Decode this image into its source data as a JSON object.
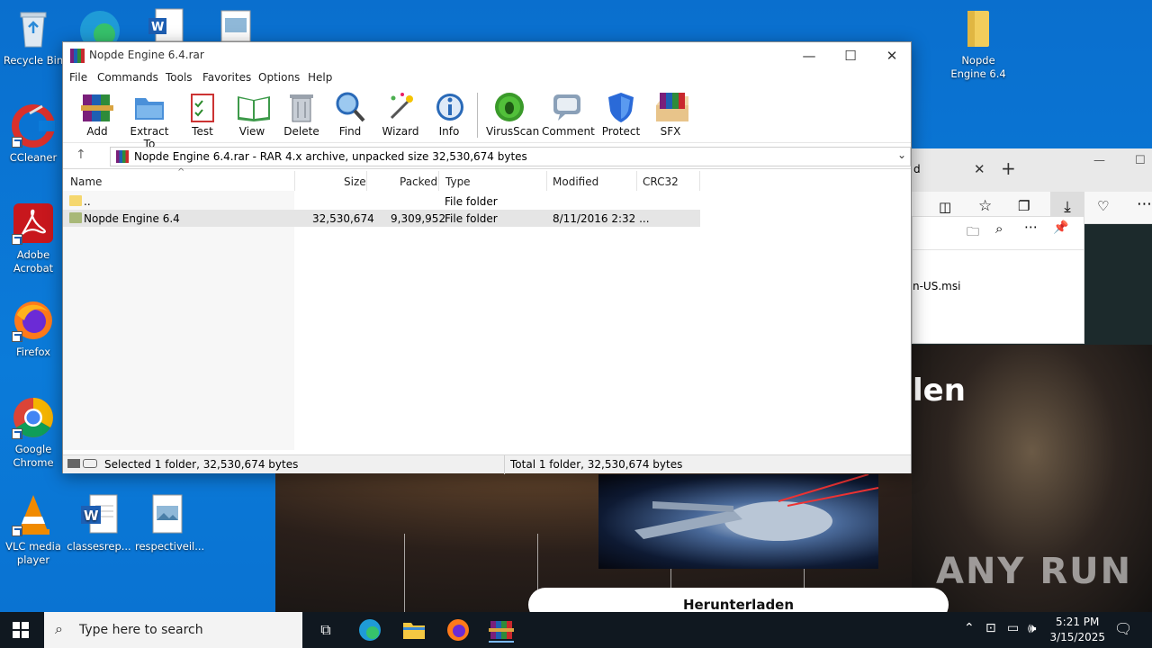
{
  "desktop_icons": [
    {
      "label": "Recycle Bin",
      "icon": "recycle-bin-icon"
    },
    {
      "label": "CCleaner",
      "icon": "ccleaner-icon"
    },
    {
      "label": "Adobe Acrobat",
      "icon": "acrobat-icon"
    },
    {
      "label": "Firefox",
      "icon": "firefox-icon"
    },
    {
      "label": "Google Chrome",
      "icon": "chrome-icon"
    },
    {
      "label": "VLC media player",
      "icon": "vlc-icon"
    },
    {
      "label": "classesrep...",
      "icon": "word-doc-icon"
    },
    {
      "label": "respectiveil...",
      "icon": "image-file-icon"
    },
    {
      "label": "Nopde Engine 6.4",
      "icon": "folder-icon"
    }
  ],
  "winrar": {
    "title": "Nopde Engine 6.4.rar",
    "window_buttons": {
      "minimize": "—",
      "maximize": "☐",
      "close": "✕"
    },
    "menu": [
      "File",
      "Commands",
      "Tools",
      "Favorites",
      "Options",
      "Help"
    ],
    "toolbar": [
      {
        "label": "Add",
        "icon": "add-archive-icon"
      },
      {
        "label": "Extract To",
        "icon": "extract-folder-icon"
      },
      {
        "label": "Test",
        "icon": "test-clipboard-icon"
      },
      {
        "label": "View",
        "icon": "view-book-icon"
      },
      {
        "label": "Delete",
        "icon": "trash-icon"
      },
      {
        "label": "Find",
        "icon": "magnifier-icon"
      },
      {
        "label": "Wizard",
        "icon": "wand-icon"
      },
      {
        "label": "Info",
        "icon": "info-icon"
      },
      {
        "label": "VirusScan",
        "icon": "bug-scan-icon"
      },
      {
        "label": "Comment",
        "icon": "comment-icon"
      },
      {
        "label": "Protect",
        "icon": "shield-icon"
      },
      {
        "label": "SFX",
        "icon": "sfx-box-icon"
      }
    ],
    "address": "Nopde Engine 6.4.rar - RAR 4.x archive, unpacked size 32,530,674 bytes",
    "columns": [
      "Name",
      "Size",
      "Packed",
      "Type",
      "Modified",
      "CRC32"
    ],
    "rows": [
      {
        "name": "..",
        "size": "",
        "packed": "",
        "type": "File folder",
        "modified": "",
        "crc": "",
        "color": "#f5d76e"
      },
      {
        "name": "Nopde Engine 6.4",
        "size": "32,530,674",
        "packed": "9,309,952",
        "type": "File folder",
        "modified": "8/11/2016 2:32 ...",
        "crc": "",
        "color": "#a8b878"
      }
    ],
    "status_left": "Selected 1 folder, 32,530,674 bytes",
    "status_right": "Total 1 folder, 32,530,674 bytes"
  },
  "browser": {
    "tab_fragment": "d",
    "download_item": "n-US.msi",
    "heading_fragment": "len",
    "download_button": "Herunterladen",
    "watermark": "ANY RUN"
  },
  "taskbar": {
    "search_placeholder": "Type here to search",
    "time": "5:21 PM",
    "date": "3/15/2025"
  }
}
